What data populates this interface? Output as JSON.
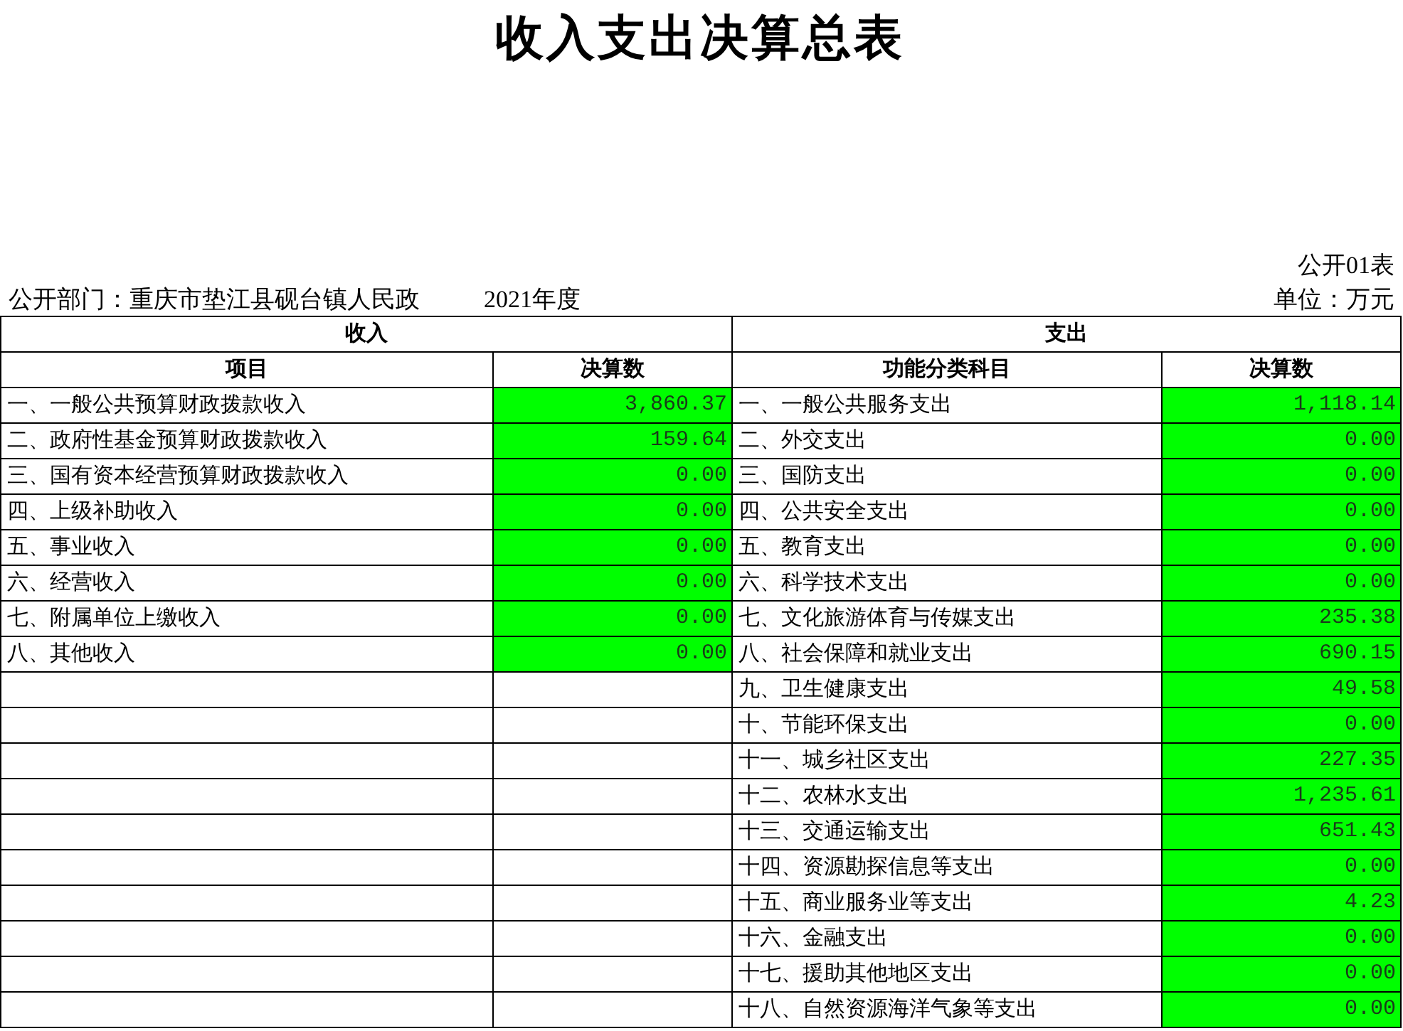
{
  "title": "收入支出决算总表",
  "table_code": "公开01表",
  "department": "公开部门：重庆市垫江县砚台镇人民政",
  "year": "2021年度",
  "unit": "单位：万元",
  "income": {
    "heading": "收入",
    "columns": [
      "项目",
      "决算数"
    ],
    "rows": [
      {
        "item": "一、一般公共预算财政拨款收入",
        "amount": "3,860.37"
      },
      {
        "item": "二、政府性基金预算财政拨款收入",
        "amount": "159.64"
      },
      {
        "item": "三、国有资本经营预算财政拨款收入",
        "amount": "0.00"
      },
      {
        "item": "四、上级补助收入",
        "amount": "0.00"
      },
      {
        "item": "五、事业收入",
        "amount": "0.00"
      },
      {
        "item": "六、经营收入",
        "amount": "0.00"
      },
      {
        "item": "七、附属单位上缴收入",
        "amount": "0.00"
      },
      {
        "item": "八、其他收入",
        "amount": "0.00"
      }
    ]
  },
  "expense": {
    "heading": "支出",
    "columns": [
      "功能分类科目",
      "决算数"
    ],
    "rows": [
      {
        "item": "一、一般公共服务支出",
        "amount": "1,118.14"
      },
      {
        "item": "二、外交支出",
        "amount": "0.00"
      },
      {
        "item": "三、国防支出",
        "amount": "0.00"
      },
      {
        "item": "四、公共安全支出",
        "amount": "0.00"
      },
      {
        "item": "五、教育支出",
        "amount": "0.00"
      },
      {
        "item": "六、科学技术支出",
        "amount": "0.00"
      },
      {
        "item": "七、文化旅游体育与传媒支出",
        "amount": "235.38"
      },
      {
        "item": "八、社会保障和就业支出",
        "amount": "690.15"
      },
      {
        "item": "九、卫生健康支出",
        "amount": "49.58"
      },
      {
        "item": "十、节能环保支出",
        "amount": "0.00"
      },
      {
        "item": "十一、城乡社区支出",
        "amount": "227.35"
      },
      {
        "item": "十二、农林水支出",
        "amount": "1,235.61"
      },
      {
        "item": "十三、交通运输支出",
        "amount": "651.43"
      },
      {
        "item": "十四、资源勘探信息等支出",
        "amount": "0.00"
      },
      {
        "item": "十五、商业服务业等支出",
        "amount": "4.23"
      },
      {
        "item": "十六、金融支出",
        "amount": "0.00"
      },
      {
        "item": "十七、援助其他地区支出",
        "amount": "0.00"
      },
      {
        "item": "十八、自然资源海洋气象等支出",
        "amount": "0.00"
      }
    ]
  }
}
